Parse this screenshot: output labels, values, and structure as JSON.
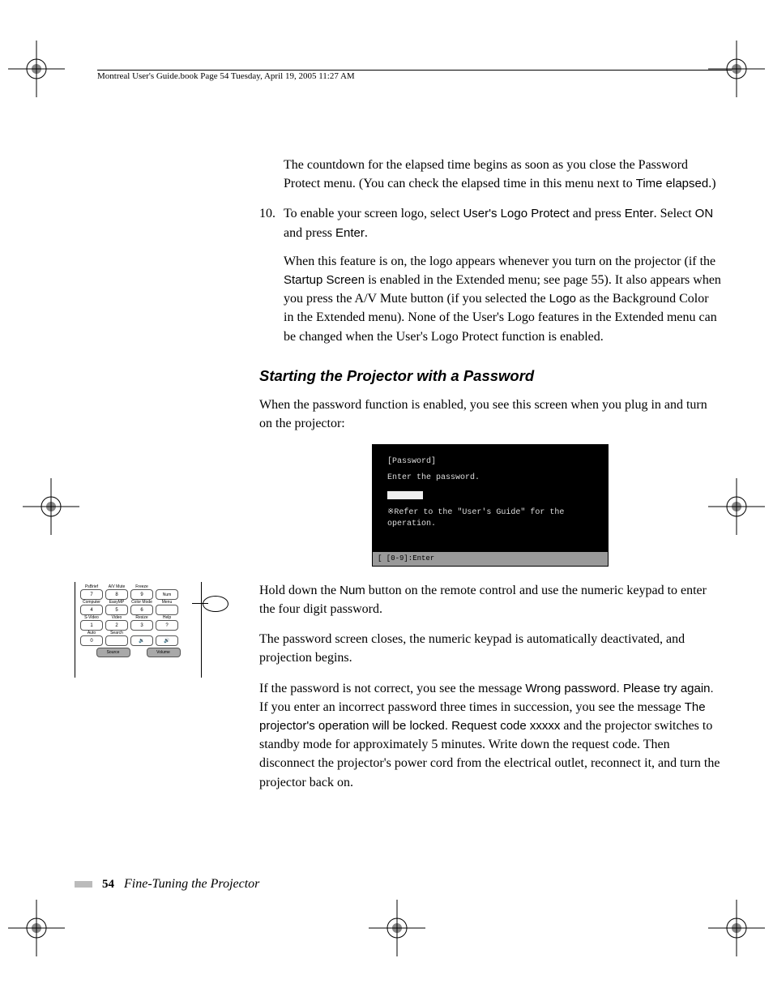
{
  "header": "Montreal User's Guide.book  Page 54  Tuesday, April 19, 2005  11:27 AM",
  "p1_a": "The countdown for the elapsed time begins as soon as you close the Password Protect menu. (You can check the elapsed time in this menu next to ",
  "p1_b": "Time elapsed",
  "p1_c": ".)",
  "li10_num": "10.",
  "li10_a": "To enable your screen logo, select ",
  "li10_b": "User's Logo Protect",
  "li10_c": " and press ",
  "li10_d": "Enter",
  "li10_e": ". Select ",
  "li10_f": "ON",
  "li10_g": " and press ",
  "li10_h": "Enter",
  "li10_i": ".",
  "p3_a": "When this feature is on, the logo appears whenever you turn on the projector (if the ",
  "p3_b": "Startup Screen",
  "p3_c": " is enabled in the Extended menu; see page 55). It also appears when you press the A/V Mute button (if you selected the ",
  "p3_d": "Logo",
  "p3_e": " as the Background Color in the Extended menu). None of the User's Logo features in the Extended menu can be changed when the User's Logo Protect function is enabled.",
  "heading": "Starting the Projector with a Password",
  "p4": "When the password function is enabled, you see this screen when you plug in and turn on the projector:",
  "screenshot": {
    "title": "[Password]",
    "line1": "Enter the password.",
    "line2": "※Refer to the \"User's Guide\" for the operation.",
    "footer": "[ [0-9]:Enter"
  },
  "p5_a": "Hold down the ",
  "p5_b": "Num",
  "p5_c": " button on the remote control and use the numeric keypad to enter the four digit password.",
  "p6": "The password screen closes, the numeric keypad is automatically deactivated, and projection begins.",
  "p7_a": "If the password is not correct, you see the message ",
  "p7_b": "Wrong password. Please try again.",
  "p7_c": " If you enter an incorrect password three times in succession, you see the message ",
  "p7_d": "The projector's operation will be locked. Request code xxxxx",
  "p7_e": " and the projector switches to standby mode for approximately 5 minutes. Write down the request code. Then disconnect the projector's power cord from the electrical outlet, reconnect it, and turn the projector back on.",
  "remote": {
    "row1_labels": [
      "PsBrief",
      "A/V Mute",
      "Freeze",
      ""
    ],
    "row1_btns": [
      "7",
      "8",
      "9",
      "Num"
    ],
    "row2_labels": [
      "Computer",
      "EasyMP",
      "Color Mode",
      "Menu"
    ],
    "row2_btns": [
      "4",
      "5",
      "6",
      ""
    ],
    "row3_labels": [
      "S-Video",
      "Video",
      "Resize",
      "Help"
    ],
    "row3_btns": [
      "1",
      "2",
      "3",
      "?"
    ],
    "row4_labels": [
      "Auto",
      "Search",
      "",
      ""
    ],
    "row4_btns": [
      "0",
      "",
      "🔉",
      "🔊"
    ],
    "bottom": [
      "Source",
      "Volume"
    ]
  },
  "footer": {
    "pageNum": "54",
    "chapter": "Fine-Tuning the Projector"
  }
}
